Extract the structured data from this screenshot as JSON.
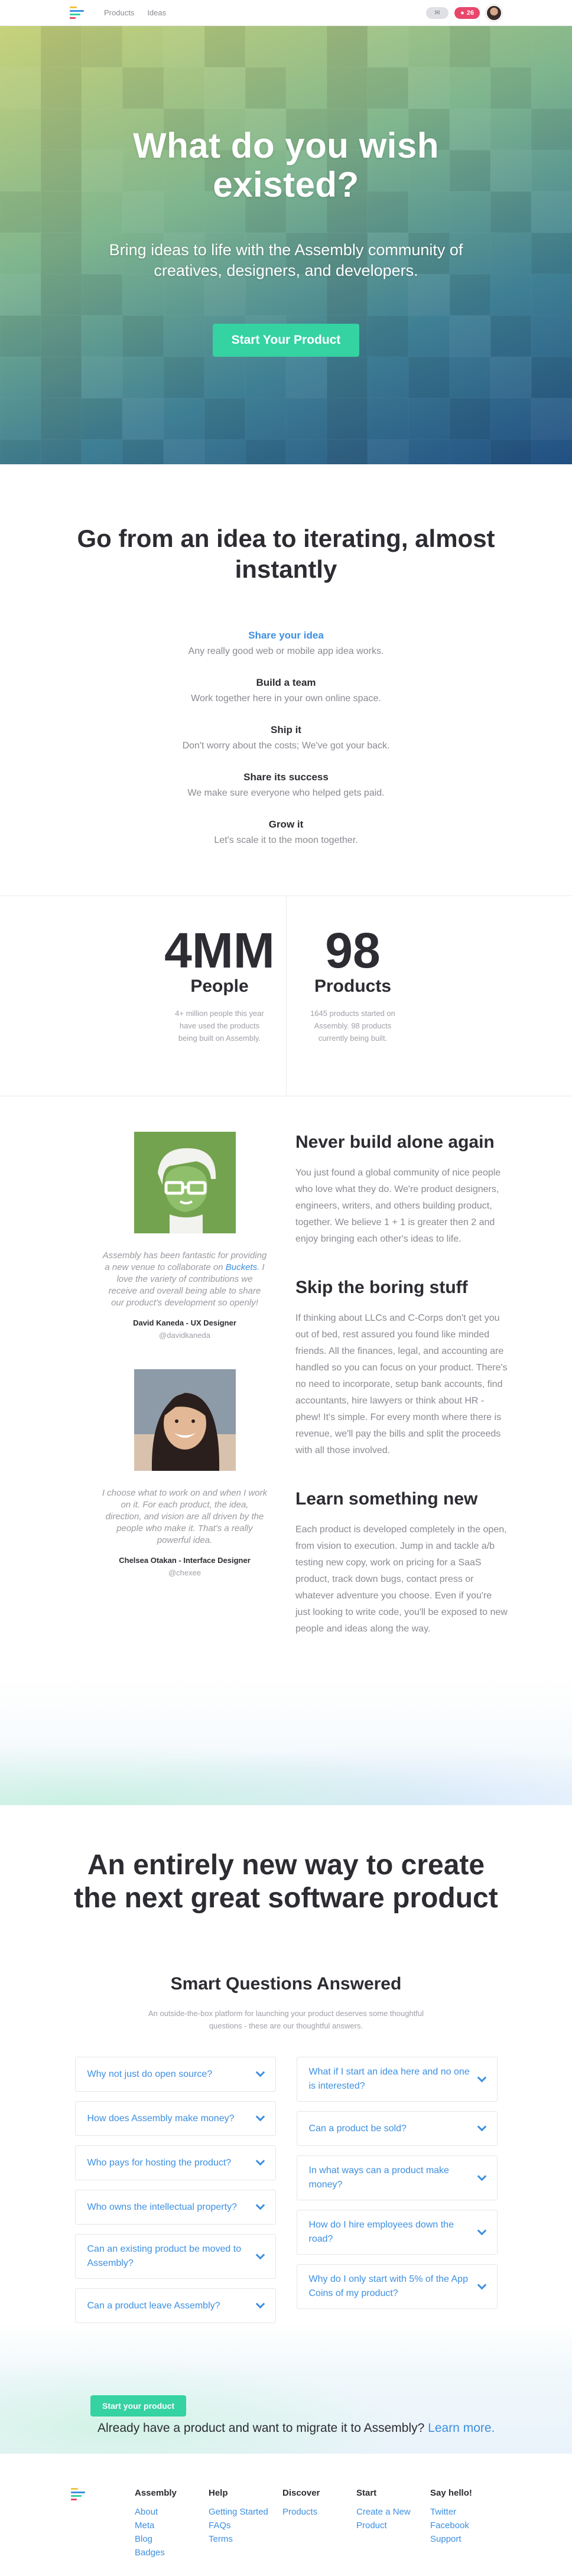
{
  "nav": {
    "links": [
      "Products",
      "Ideas"
    ],
    "notifications_label": "✉",
    "badge_count": "26"
  },
  "hero": {
    "title": "What do you wish existed?",
    "subtitle": "Bring ideas to life with the Assembly community of creatives, designers, and developers.",
    "cta": "Start Your Product"
  },
  "steps": {
    "heading": "Go from an idea to iterating, almost instantly",
    "items": [
      {
        "title": "Share your idea",
        "text": "Any really good web or mobile app idea works."
      },
      {
        "title": "Build a team",
        "text": "Work together here in your own online space."
      },
      {
        "title": "Ship it",
        "text": "Don't worry about the costs; We've got your back."
      },
      {
        "title": "Share its success",
        "text": "We make sure everyone who helped gets paid."
      },
      {
        "title": "Grow it",
        "text": "Let's scale it to the moon together."
      }
    ]
  },
  "stats": [
    {
      "number": "4MM",
      "label": "People",
      "desc": "4+ million people this year have used the products being built on Assembly."
    },
    {
      "number": "98",
      "label": "Products",
      "desc": "1645 products started on Assembly. 98 products currently being built."
    }
  ],
  "testimonials": [
    {
      "quote_before": "Assembly has been fantastic for providing a new venue to collaborate on ",
      "quote_link": "Buckets",
      "quote_after": ". I love the variety of contributions we receive and overall being able to share our product's development so openly!",
      "name": "David Kaneda - UX Designer",
      "handle": "@davidkaneda"
    },
    {
      "quote_before": "I choose what to work on and when I work on it. For each product, the idea, direction, and vision are all driven by the people who make it. That's a really powerful idea.",
      "quote_link": "",
      "quote_after": "",
      "name": "Chelsea Otakan - Interface Designer",
      "handle": "@chexee"
    }
  ],
  "features": [
    {
      "title": "Never build alone again",
      "text": "You just found a global community of nice people who love what they do. We're product designers, engineers, writers, and others building product, together. We believe 1 + 1 is greater then 2 and enjoy bringing each other's ideas to life."
    },
    {
      "title": "Skip the boring stuff",
      "text": "If thinking about LLCs and C-Corps don't get you out of bed, rest assured you found like minded friends. All the finances, legal, and accounting are handled so you can focus on your product. There's no need to incorporate, setup bank accounts, find accountants, hire lawyers or think about HR - phew! It's simple. For every month where there is revenue, we'll pay the bills and split the proceeds with all those involved."
    },
    {
      "title": "Learn something new",
      "text": "Each product is developed completely in the open, from vision to execution. Jump in and tackle a/b testing new copy, work on pricing for a SaaS product, track down bugs, contact press or whatever adventure you choose. Even if you're just looking to write code, you'll be exposed to new people and ideas along the way."
    }
  ],
  "newway": {
    "heading": "An entirely new way to create the next great software product",
    "faq_title": "Smart Questions Answered",
    "faq_subtitle": "An outside-the-box platform for launching your product deserves some thoughtful questions - these are our thoughtful answers.",
    "faq_left": [
      "Why not just do open source?",
      "How does Assembly make money?",
      "Who pays for hosting the product?",
      "Who owns the intellectual property?",
      "Can an existing product be moved to Assembly?",
      "Can a product leave Assembly?"
    ],
    "faq_right": [
      "What if I start an idea here and no one is interested?",
      "Can a product be sold?",
      "In what ways can a product make money?",
      "How do I hire employees down the road?",
      "Why do I only start with 5% of the App Coins of my product?"
    ]
  },
  "migrate": {
    "button": "Start your product",
    "text": "Already have a product and want to migrate it to Assembly?",
    "link": "Learn more."
  },
  "footer": {
    "columns": [
      {
        "title": "Assembly",
        "links": [
          "About",
          "Meta",
          "Blog",
          "Badges"
        ]
      },
      {
        "title": "Help",
        "links": [
          "Getting Started",
          "FAQs",
          "Terms"
        ]
      },
      {
        "title": "Discover",
        "links": [
          "Products"
        ]
      },
      {
        "title": "Start",
        "links": [
          "Create a New Product"
        ]
      },
      {
        "title": "Say hello!",
        "links": [
          "Twitter",
          "Facebook",
          "Support"
        ]
      }
    ]
  },
  "colors": {
    "accent_blue": "#3d8fe0",
    "accent_green": "#35d2a2",
    "badge_red": "#e9466b",
    "logo_bars": [
      "#f6c244",
      "#3d8fe0",
      "#35d2a2",
      "#e9466b"
    ]
  }
}
